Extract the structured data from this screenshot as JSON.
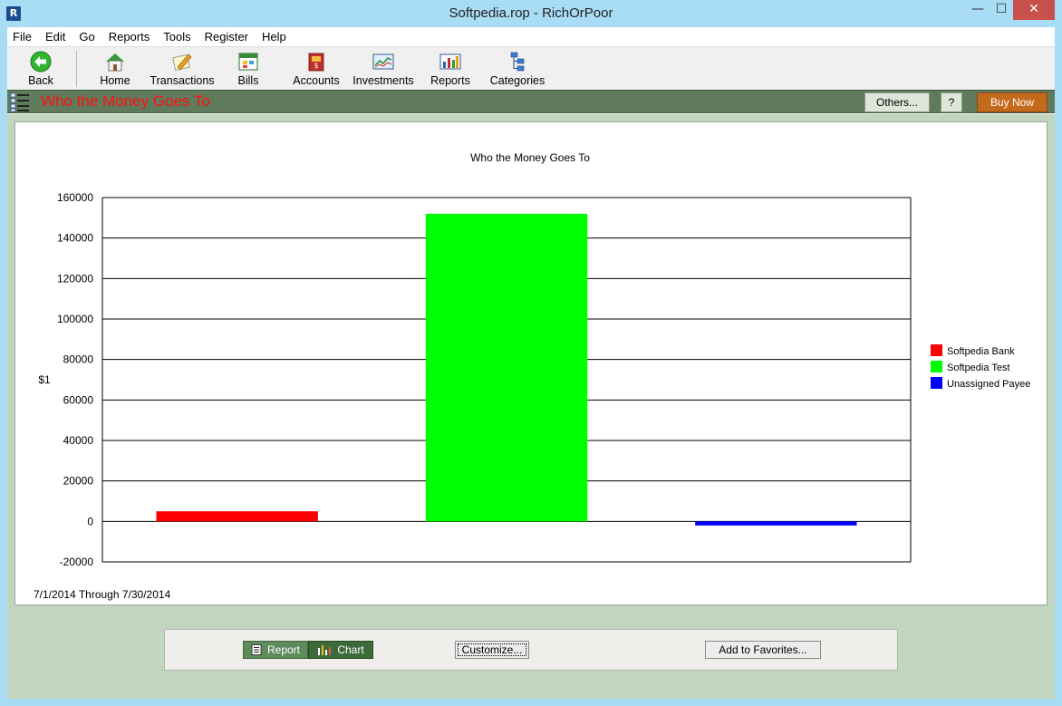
{
  "window": {
    "title": "Softpedia.rop - RichOrPoor",
    "app_icon_letter": "R",
    "minimize": "—",
    "maximize": "☐",
    "close": "✕"
  },
  "menu": [
    "File",
    "Edit",
    "Go",
    "Reports",
    "Tools",
    "Register",
    "Help"
  ],
  "toolbar": {
    "back": "Back",
    "home": "Home",
    "transactions": "Transactions",
    "bills": "Bills",
    "accounts": "Accounts",
    "investments": "Investments",
    "reports": "Reports",
    "categories": "Categories"
  },
  "report_header": {
    "title": "Who the Money Goes To",
    "others": "Others...",
    "help": "?",
    "buy_now": "Buy Now"
  },
  "colors": {
    "report_bar": "#5f7b5c",
    "title_red": "#ff1010",
    "buy_now": "#c46a1d"
  },
  "chart_data": {
    "type": "bar",
    "title": "Who the Money Goes To",
    "ylabel": "$1",
    "xlabel": "",
    "ylim": [
      -20000,
      160000
    ],
    "yticks": [
      160000,
      140000,
      120000,
      100000,
      80000,
      60000,
      40000,
      20000,
      0,
      -20000
    ],
    "grid": true,
    "legend_position": "right",
    "series": [
      {
        "name": "Softpedia Bank",
        "value": 5000,
        "color": "#ff0000"
      },
      {
        "name": "Softpedia Test",
        "value": 152000,
        "color": "#00ff00"
      },
      {
        "name": "Unassigned Payee",
        "value": -2000,
        "color": "#0000ff"
      }
    ],
    "date_range": "7/1/2014 Through 7/30/2014"
  },
  "bottom": {
    "report": "Report",
    "chart": "Chart",
    "customize": "Customize...",
    "add_favorites": "Add to Favorites..."
  }
}
